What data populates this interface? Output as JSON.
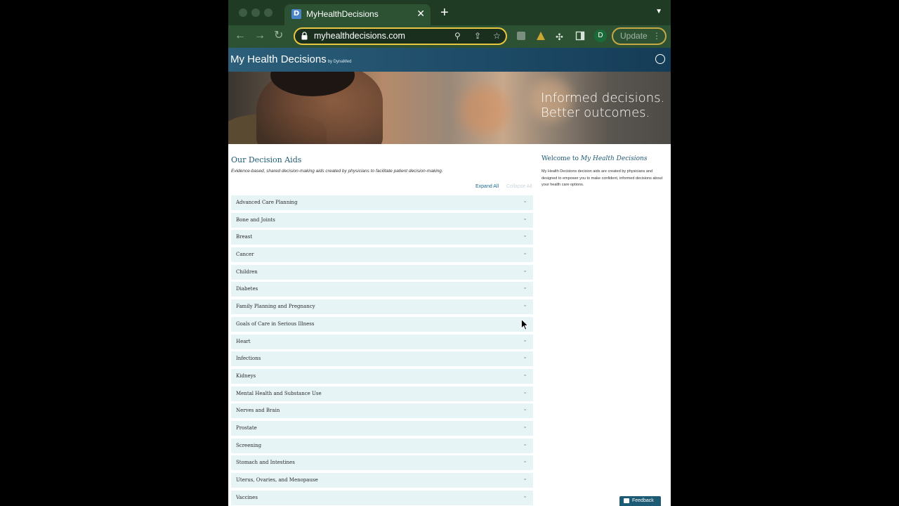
{
  "browser": {
    "tab_title": "MyHealthDecisions",
    "tab_favicon_letter": "D",
    "url": "myhealthdecisions.com",
    "profile_initial": "D",
    "update_label": "Update"
  },
  "site": {
    "brand": "My Health Decisions",
    "brand_by": "by DynaMed",
    "hero_line1": "Informed decisions.",
    "hero_line2": "Better outcomes."
  },
  "main": {
    "title": "Our Decision Aids",
    "subtitle": "Evidence-based, shared decision-making aids created by physicians to facilitate patient decision-making.",
    "expand_all": "Expand All",
    "collapse_all": "Collapse All",
    "aids": [
      "Advanced Care Planning",
      "Bone and Joints",
      "Breast",
      "Cancer",
      "Children",
      "Diabetes",
      "Family Planning and Pregnancy",
      "Goals of Care in Serious Illness",
      "Heart",
      "Infections",
      "Kidneys",
      "Mental Health and Substance Use",
      "Nerves and Brain",
      "Prostate",
      "Screening",
      "Stomach and Intestines",
      "Uterus, Ovaries, and Menopause",
      "Vaccines"
    ]
  },
  "sidebar": {
    "welcome_prefix": "Welcome to ",
    "welcome_brand": "My Health Decisions",
    "welcome_text": "My Health Decisions decision aids are created by physicians and designed to empower you to make confident, informed decisions about your health care options."
  },
  "feedback_label": "Feedback",
  "colors": {
    "accent": "#1d5a73",
    "browser_frame": "#2d5233",
    "row_bg": "#e6f4f6"
  }
}
